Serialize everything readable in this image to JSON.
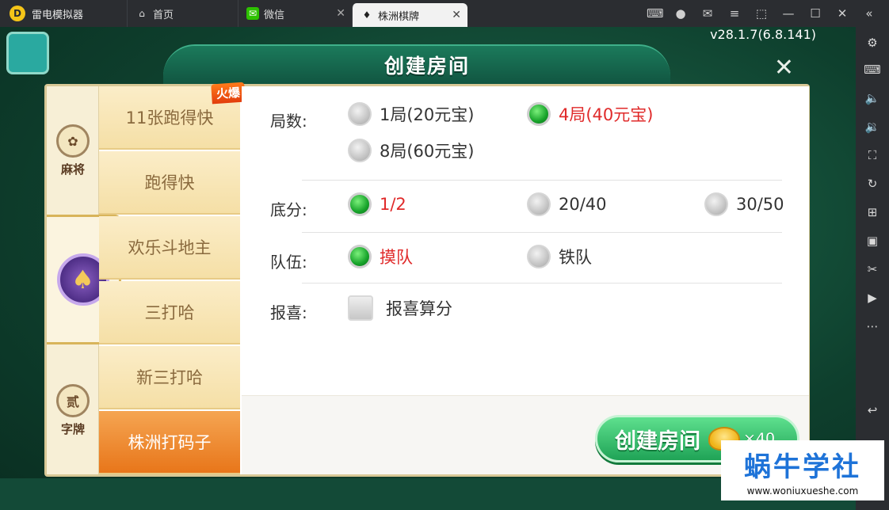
{
  "titlebar": {
    "app_name": "雷电模拟器",
    "tabs": [
      {
        "label": "首页"
      },
      {
        "label": "微信"
      },
      {
        "label": "株洲棋牌"
      }
    ],
    "right_icons": [
      "gamepad-icon",
      "user-icon",
      "mail-icon",
      "menu-icon",
      "screenshot-icon",
      "minimize-icon",
      "maximize-icon",
      "close-icon"
    ]
  },
  "sidebar": {
    "buttons": [
      "settings-icon",
      "keyboard-icon",
      "volume-up-icon",
      "volume-down-icon",
      "fullscreen-icon",
      "rotate-icon",
      "add-app-icon",
      "apk-icon",
      "scissors-icon",
      "video-icon",
      "more-icon",
      "back-icon"
    ]
  },
  "game": {
    "version": "v28.1.7(6.8.141)"
  },
  "dialog": {
    "title": "创建房间",
    "close_symbol": "✕",
    "categories": [
      {
        "label": "麻将",
        "icon": "mahjong-icon"
      },
      {
        "label": "",
        "icon": "spade-icon"
      },
      {
        "label": "字牌",
        "icon": "zipai-icon",
        "icon_text": "贰"
      }
    ],
    "games": [
      {
        "label": "11张跑得快",
        "badge": "火爆"
      },
      {
        "label": "跑得快"
      },
      {
        "label": "欢乐斗地主"
      },
      {
        "label": "三打哈"
      },
      {
        "label": "新三打哈"
      },
      {
        "label": "株洲打码子",
        "selected": true
      }
    ],
    "options": {
      "rounds": {
        "label": "局数:",
        "choices": [
          {
            "label": "1局(20元宝)",
            "selected": false
          },
          {
            "label": "4局(40元宝)",
            "selected": true
          },
          {
            "label": "8局(60元宝)",
            "selected": false
          }
        ]
      },
      "base_score": {
        "label": "底分:",
        "choices": [
          {
            "label": "1/2",
            "selected": true
          },
          {
            "label": "20/40",
            "selected": false
          },
          {
            "label": "30/50",
            "selected": false
          }
        ]
      },
      "team": {
        "label": "队伍:",
        "choices": [
          {
            "label": "摸队",
            "selected": true
          },
          {
            "label": "铁队",
            "selected": false
          }
        ]
      },
      "report": {
        "label": "报喜:",
        "checkbox_label": "报喜算分",
        "checked": false
      }
    },
    "create_button": {
      "label": "创建房间",
      "cost": "×40"
    }
  },
  "watermark": {
    "main": "蜗牛学社",
    "url": "www.woniuxueshe.com"
  },
  "colors": {
    "selected_text": "#e02a2a",
    "radio_on": "#17a32a",
    "accent_orange": "#e8761a",
    "watermark_blue": "#1e73d8"
  }
}
